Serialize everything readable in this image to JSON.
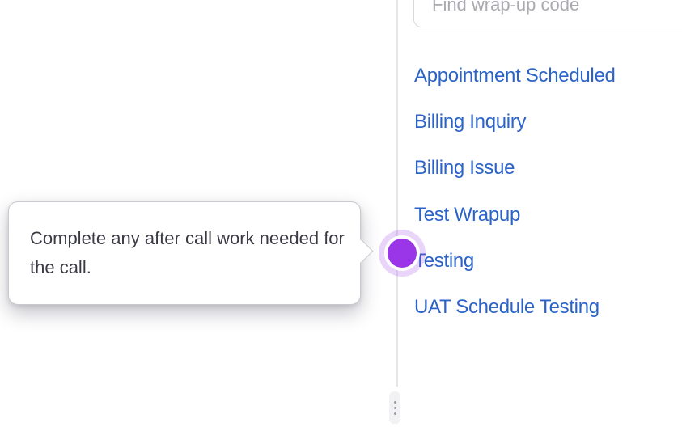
{
  "search": {
    "placeholder": "Find wrap-up code"
  },
  "wrapup_codes": [
    {
      "label": "Appointment Scheduled"
    },
    {
      "label": "Billing Inquiry"
    },
    {
      "label": "Billing Issue"
    },
    {
      "label": "Test Wrapup"
    },
    {
      "label": "Testing"
    },
    {
      "label": "UAT Schedule Testing"
    }
  ],
  "tooltip": {
    "text": "Complete any after call work needed for the call."
  },
  "colors": {
    "link": "#2b63c8",
    "hotspot": "#9b35e8",
    "tooltip_text": "#3a3a44"
  }
}
